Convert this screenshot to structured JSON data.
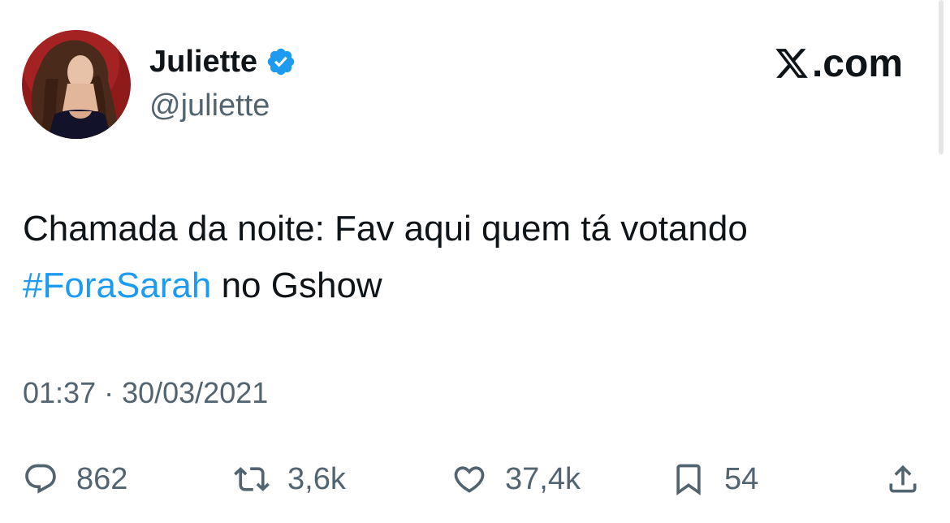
{
  "author": {
    "display_name": "Juliette",
    "handle": "@juliette",
    "verified": true,
    "avatar": "profile-photo"
  },
  "site": {
    "logo_icon": "x-logo-icon",
    "logo_suffix": ".com"
  },
  "tweet": {
    "text_line1": "Chamada da noite: Fav aqui quem tá votando",
    "hashtag": "#ForaSarah",
    "text_after_hashtag": " no Gshow",
    "timestamp": "01:37 · 30/03/2021"
  },
  "actions": {
    "replies": {
      "icon": "reply-icon",
      "count": "862"
    },
    "retweets": {
      "icon": "retweet-icon",
      "count": "3,6k"
    },
    "likes": {
      "icon": "heart-icon",
      "count": "37,4k"
    },
    "bookmarks": {
      "icon": "bookmark-icon",
      "count": "54"
    },
    "share": {
      "icon": "share-icon"
    }
  },
  "colors": {
    "text": "#0f1419",
    "secondary_text": "#536471",
    "link": "#1d9bf0",
    "verified_badge": "#1d9bf0"
  }
}
